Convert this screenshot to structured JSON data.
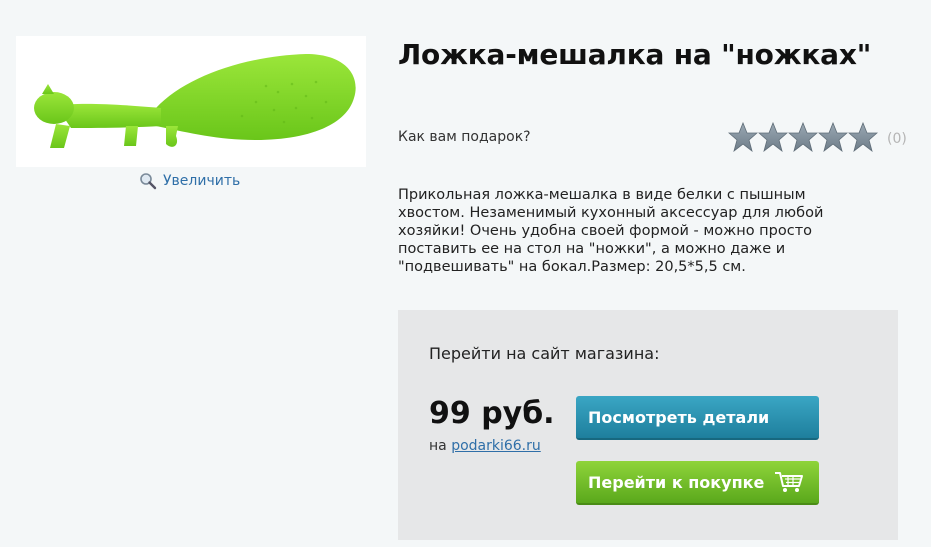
{
  "product": {
    "title": "Ложка-мешалка на \"ножках\"",
    "image_alt": "green squirrel-shaped rice spoon",
    "image_color": "#7ed321",
    "zoom_label": "Увеличить",
    "description": "Прикольная ложка-мешалка в виде белки с пышным хвостом. Незаменимый кухонный аксессуар для любой хозяйки! Очень удобна своей формой - можно просто поставить ее на стол на \"ножки\", а можно даже и \"подвешивать\" на бокал.Размер: 20,5*5,5 см."
  },
  "rating": {
    "question": "Как вам подарок?",
    "stars_total": 5,
    "stars_filled": 0,
    "count_text": "(0)"
  },
  "shop": {
    "heading": "Перейти на сайт магазина:",
    "price": "99 руб.",
    "source_prefix": "на",
    "source_link": "podarki66.ru",
    "details_button": "Посмотреть детали",
    "buy_button": "Перейти к покупке",
    "colors": {
      "details_button": "#2a93b3",
      "buy_button": "#74bf2a",
      "link": "#2f6fa8"
    }
  }
}
